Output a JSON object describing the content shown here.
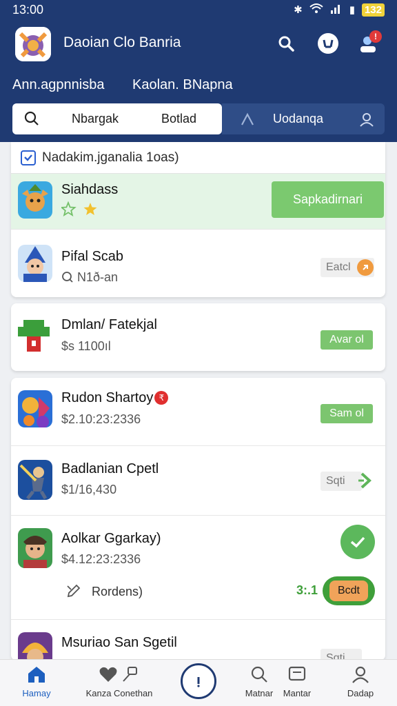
{
  "status_bar": {
    "time": "13:00",
    "battery": "132"
  },
  "header": {
    "app_title": "Daoian Clo Banria",
    "tabs": [
      "Ann.agpnnisba",
      "Kaolan. BNapna"
    ],
    "search_tab_label": "Nbargak",
    "search_tab_label2": "Botlad",
    "dark_tab_label": "Uodanqa",
    "notification_badge": "!"
  },
  "filter": {
    "text": "Nadakim.jganalia 1oas)"
  },
  "items": [
    {
      "title": "Siahdass",
      "action_label": "Sapkadirnari",
      "highlighted": true
    },
    {
      "title": "Pifal Scab",
      "subtitle": "N1ð-an",
      "action_label": "Eatcl"
    },
    {
      "title": "Dmlan/ Fatekjal",
      "subtitle": "$s 1100ıl",
      "action_label": "Avar ol"
    },
    {
      "title": "Rudon Shartoy",
      "subtitle": "$2.10:23:2336",
      "action_label": "Sam ol",
      "badge": "₹"
    },
    {
      "title": "Badlanian Cpetl",
      "subtitle": "$1/16,430",
      "action_label": "Sqti"
    },
    {
      "title": "Aolkar Ggarkay)",
      "subtitle": "$4.12:23:2336",
      "meta_label": "Rordens)",
      "count": "3:.1",
      "pill_label": "Bcdt"
    },
    {
      "title": "Msuriao San Sgetil",
      "action_label": "Sqti"
    }
  ],
  "bottom_nav": {
    "items": [
      "Hamay",
      "Kanza Conethan",
      "Matnar",
      "Mantar",
      "Dadap"
    ]
  },
  "colors": {
    "header_bg": "#1f3a72",
    "accent_green": "#7bc96f",
    "highlight_bg": "#e4f5e6",
    "orange": "#f09a3e"
  }
}
